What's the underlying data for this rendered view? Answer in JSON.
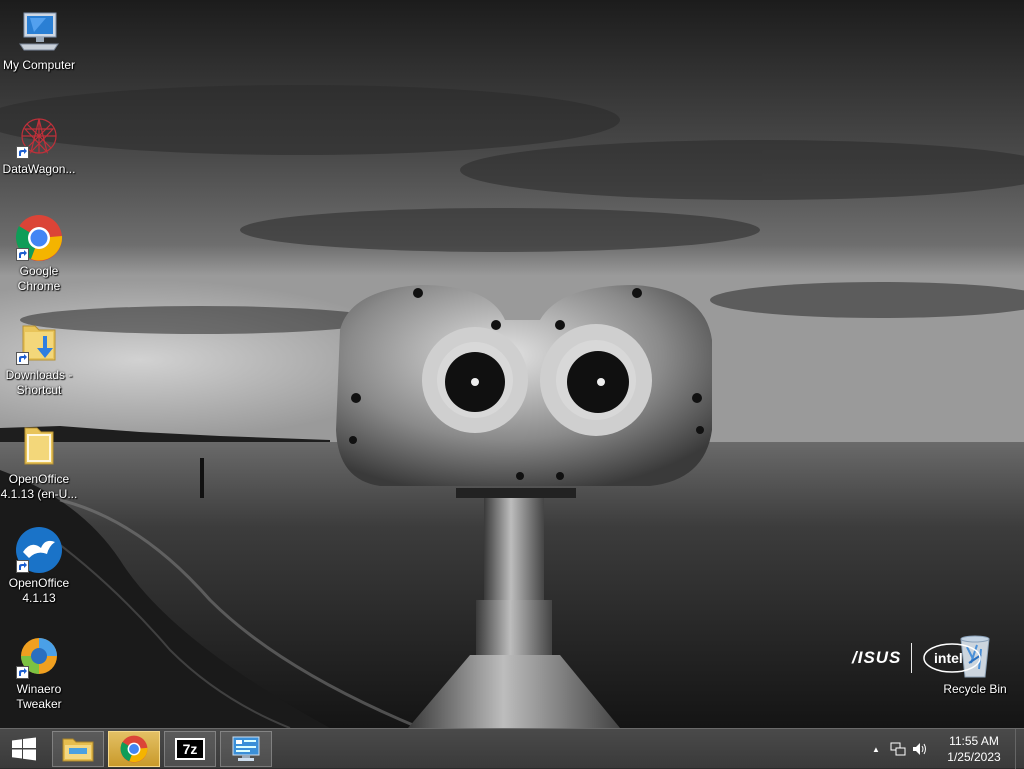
{
  "desktop": {
    "icons": [
      {
        "label": "My Computer",
        "icon": "computer-icon"
      },
      {
        "label": "DataWagon...",
        "icon": "datawagon-icon"
      },
      {
        "label": "Google\nChrome",
        "icon": "chrome-icon"
      },
      {
        "label": "Downloads -\nShortcut",
        "icon": "downloads-folder-icon"
      },
      {
        "label": "OpenOffice\n4.1.13 (en-U...",
        "icon": "folder-icon"
      },
      {
        "label": "OpenOffice\n4.1.13",
        "icon": "openoffice-icon"
      },
      {
        "label": "Winaero\nTweaker",
        "icon": "winaero-icon"
      }
    ],
    "recycle_bin": {
      "label": "Recycle Bin",
      "icon": "recycle-bin-icon"
    },
    "branding": {
      "asus": "/ISUS",
      "intel": "intel"
    }
  },
  "taskbar": {
    "start_icon": "windows-logo-icon",
    "pinned": [
      {
        "name": "file-explorer",
        "icon": "file-explorer-icon"
      },
      {
        "name": "chrome",
        "icon": "chrome-icon"
      },
      {
        "name": "7zip",
        "icon": "7zip-icon",
        "text": "7z"
      },
      {
        "name": "control-panel",
        "icon": "control-panel-icon"
      }
    ],
    "tray": {
      "chevron": "▲",
      "time": "11:55 AM",
      "date": "1/25/2023"
    }
  },
  "colors": {
    "taskbar_bg": "#3f3f3f",
    "active_button": "#d6aa45"
  }
}
